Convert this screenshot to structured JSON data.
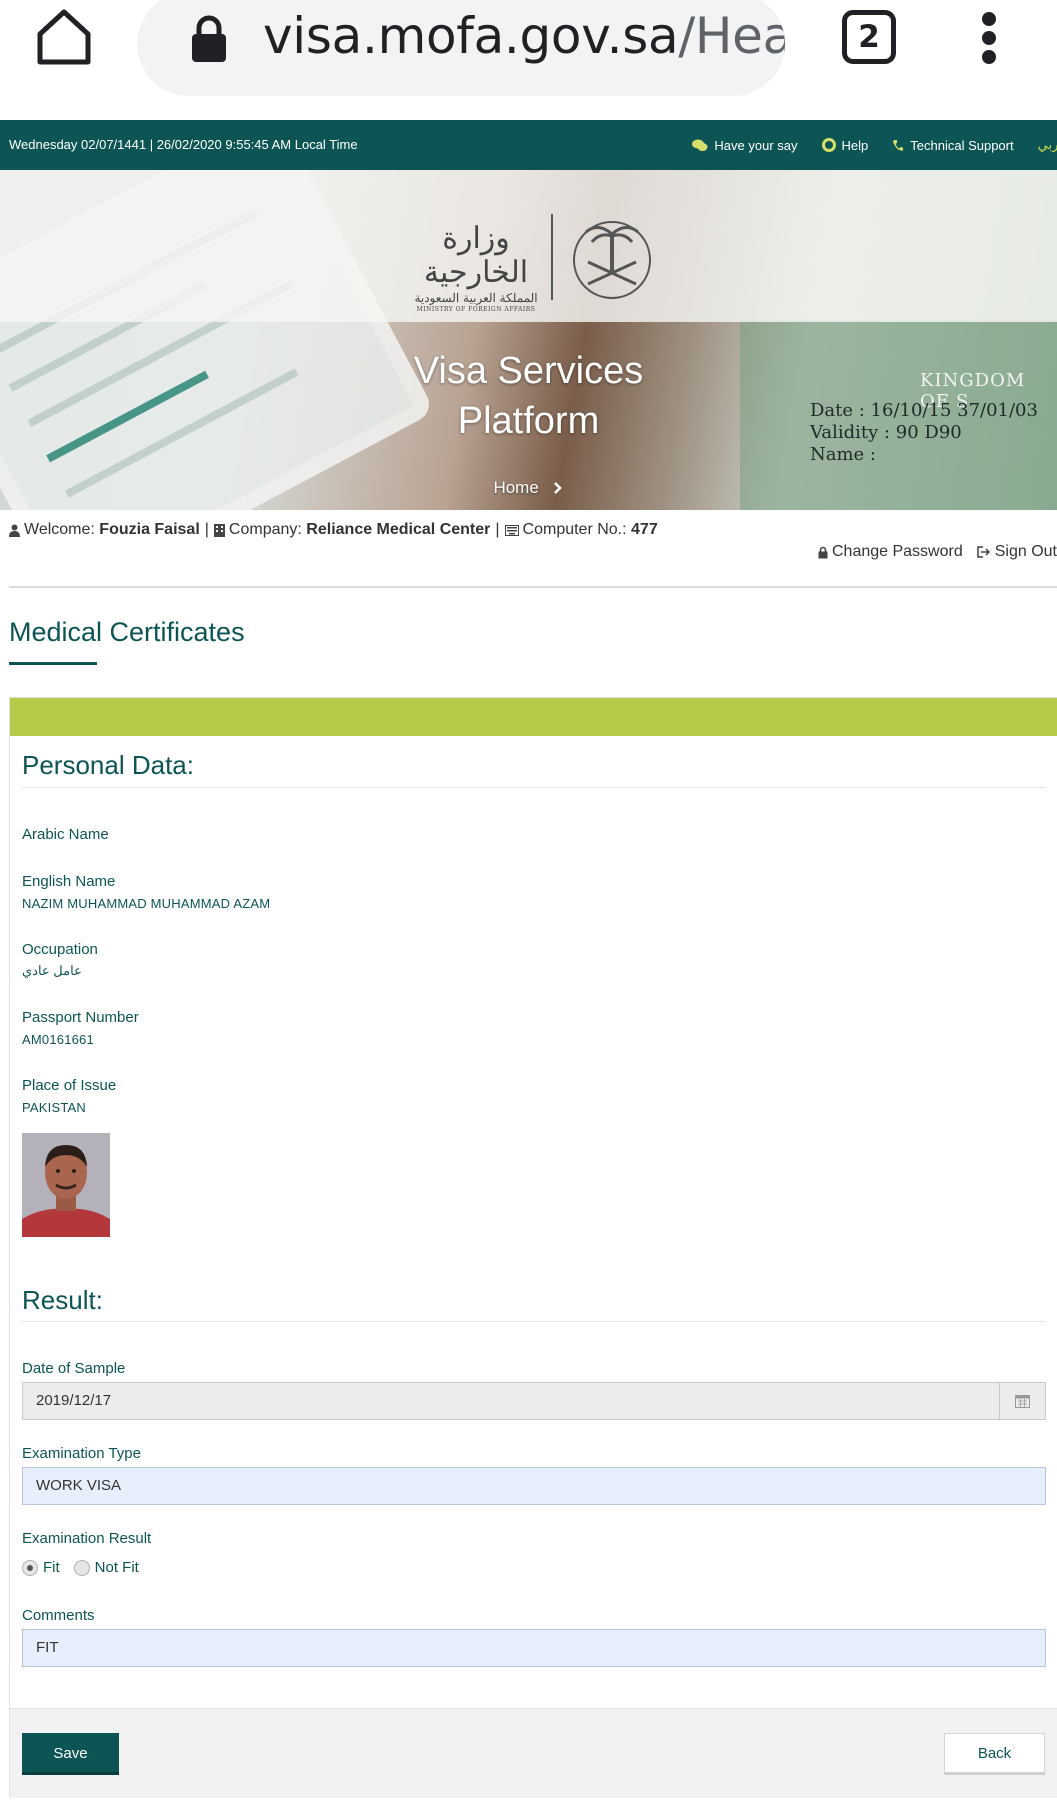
{
  "browser": {
    "url_domain": "visa.mofa.gov.sa",
    "url_path": "/Healt",
    "tab_count": "2"
  },
  "topbar": {
    "datetime": "Wednesday 02/07/1441 | 26/02/2020 9:55:45 AM Local Time",
    "have_your_say": "Have your say",
    "help": "Help",
    "technical_support": "Technical Support",
    "language": "عربي"
  },
  "hero": {
    "logo_arabic_line1": "وزارة الخارجية",
    "logo_arabic_line2": "المملكة العربية السعودية",
    "logo_english": "MINISTRY OF FOREIGN AFFAIRS",
    "title_line1": "Visa Services",
    "title_line2": "Platform",
    "breadcrumb_home": "Home",
    "visa_text_date": "Date :  16/10/15  37/01/03",
    "visa_text_validity": "Validity :  90 D90",
    "visa_text_name": "Name :",
    "visa_kingdom": "KINGDOM OF S"
  },
  "user": {
    "welcome_label": "Welcome:",
    "welcome_name": "Fouzia Faisal",
    "company_label": "Company:",
    "company_name": "Reliance Medical Center",
    "computer_label": "Computer No.:",
    "computer_no": "477",
    "change_password": "Change Password",
    "sign_out": "Sign Out"
  },
  "page": {
    "title": "Medical Certificates"
  },
  "personal": {
    "heading": "Personal Data:",
    "arabic_name_label": "Arabic Name",
    "arabic_name_value": "",
    "english_name_label": "English Name",
    "english_name_value": "NAZIM MUHAMMAD MUHAMMAD AZAM",
    "occupation_label": "Occupation",
    "occupation_value": "عامل عادي",
    "passport_label": "Passport Number",
    "passport_value": "AM0161661",
    "place_label": "Place of Issue",
    "place_value": "PAKISTAN"
  },
  "result": {
    "heading": "Result:",
    "date_label": "Date of Sample",
    "date_value": "2019/12/17",
    "exam_type_label": "Examination Type",
    "exam_type_value": "WORK VISA",
    "exam_result_label": "Examination Result",
    "option_fit": "Fit",
    "option_not_fit": "Not Fit",
    "selected_option": "Fit",
    "comments_label": "Comments",
    "comments_value": "FIT"
  },
  "actions": {
    "save": "Save",
    "back": "Back"
  },
  "colors": {
    "brand_teal": "#0d5555",
    "accent_green": "#b5cc4b",
    "language_link": "#c6d94a",
    "input_blue": "#e8effc"
  },
  "icons": {
    "home": "home-icon",
    "lock": "lock-icon",
    "menu": "more-vert-icon",
    "have_your_say": "comments-icon",
    "help": "lifebuoy-icon",
    "support": "phone-icon",
    "user": "user-icon",
    "company": "building-icon",
    "computer": "keyboard-icon",
    "change_password": "lock-icon",
    "sign_out": "sign-out-icon",
    "calendar": "calendar-icon",
    "breadcrumb": "chevron-right-icon"
  }
}
